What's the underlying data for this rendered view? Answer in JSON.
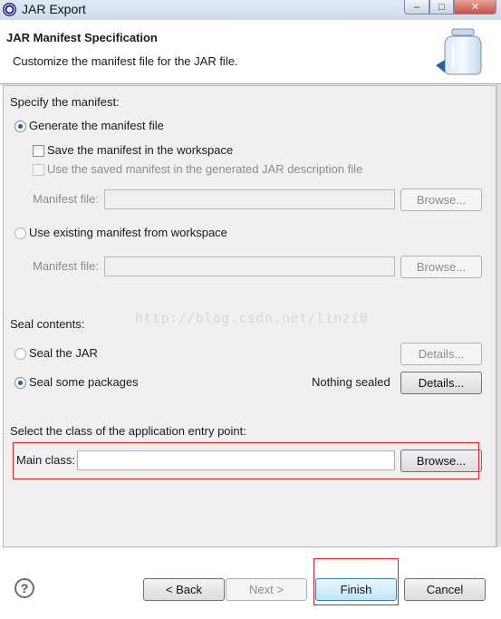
{
  "window": {
    "title": "JAR Export",
    "min_glyph": "–",
    "max_glyph": "□",
    "close_glyph": "✕"
  },
  "header": {
    "title": "JAR Manifest Specification",
    "subtitle": "Customize the manifest file for the JAR file."
  },
  "manifest": {
    "section_label": "Specify the manifest:",
    "generate_label": "Generate the manifest file",
    "generate_checked": true,
    "save_label": "Save the manifest in the workspace",
    "use_saved_label": "Use the saved manifest in the generated JAR description file",
    "manifest_file_label": "Manifest file:",
    "browse_label": "Browse...",
    "use_existing_label": "Use existing manifest from workspace"
  },
  "seal": {
    "section_label": "Seal contents:",
    "seal_jar_label": "Seal the JAR",
    "seal_packages_label": "Seal some packages",
    "nothing_sealed": "Nothing sealed",
    "details_label": "Details..."
  },
  "entry": {
    "section_label": "Select the class of the application entry point:",
    "main_class_label": "Main class:",
    "main_class_value": "",
    "browse_label": "Browse..."
  },
  "watermark": "http://blog.csdn.net/linzi0",
  "buttons": {
    "help": "?",
    "back": "< Back",
    "next": "Next >",
    "finish": "Finish",
    "cancel": "Cancel"
  },
  "colors": {
    "highlight_box": "#e21a1a",
    "radio_dot": "#1f5fa8"
  }
}
